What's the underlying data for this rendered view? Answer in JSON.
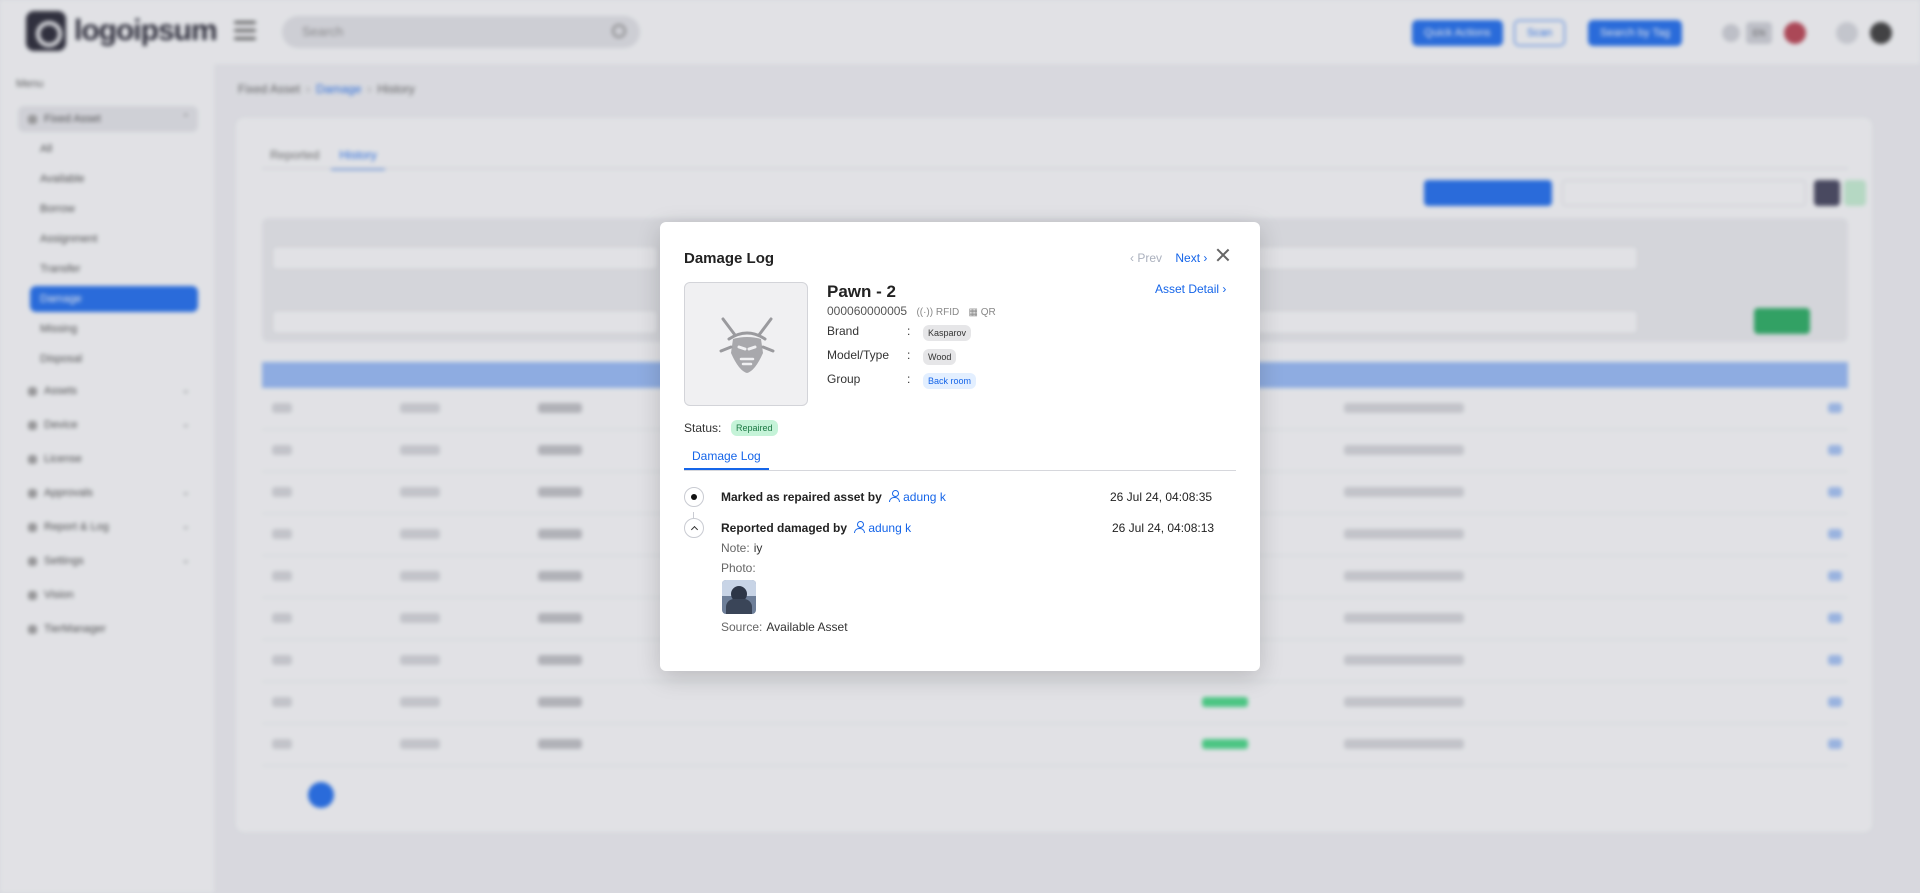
{
  "topbar": {
    "logo_text": "logoipsum",
    "search_placeholder": "Search",
    "btn_quick_actions": "Quick Actions",
    "btn_scan": "Scan",
    "btn_search_tag": "Search by Tag",
    "lang": "EN"
  },
  "sidebar": {
    "menu_title": "Menu",
    "items": [
      "Fixed Asset",
      "Assets",
      "Device",
      "License",
      "Approvals",
      "Report & Log",
      "Settings",
      "Vision",
      "TierManager"
    ],
    "subitems": [
      "All",
      "Available",
      "Borrow",
      "Assignment",
      "Transfer",
      "Damage",
      "Missing",
      "Disposal"
    ]
  },
  "breadcrumb": {
    "root": "Fixed Asset",
    "section": "Damage",
    "page": "History"
  },
  "main_tabs": [
    "Reported",
    "History"
  ],
  "modal": {
    "title": "Damage Log",
    "prev": "‹ Prev",
    "next": "Next ›",
    "asset_detail": "Asset Detail ›",
    "asset_name": "Pawn - 2",
    "asset_code": "000060000005",
    "tag_rfid": "((·)) RFID",
    "tag_qr": "▦ QR",
    "brand_label": "Brand",
    "brand_value": "Kasparov",
    "model_label": "Model/Type",
    "model_value": "Wood",
    "group_label": "Group",
    "group_value": "Back room",
    "status_label": "Status:",
    "status_value": "Repaired",
    "log_tab": "Damage Log",
    "events": [
      {
        "text": "Marked as repaired asset by",
        "user": "adung k",
        "time": "26 Jul 24, 04:08:35"
      },
      {
        "text": "Reported damaged by",
        "user": "adung k",
        "time": "26 Jul 24, 04:08:13",
        "note_label": "Note:",
        "note_value": "iy",
        "photo_label": "Photo:",
        "source_label": "Source:",
        "source_value": "Available Asset"
      }
    ]
  }
}
